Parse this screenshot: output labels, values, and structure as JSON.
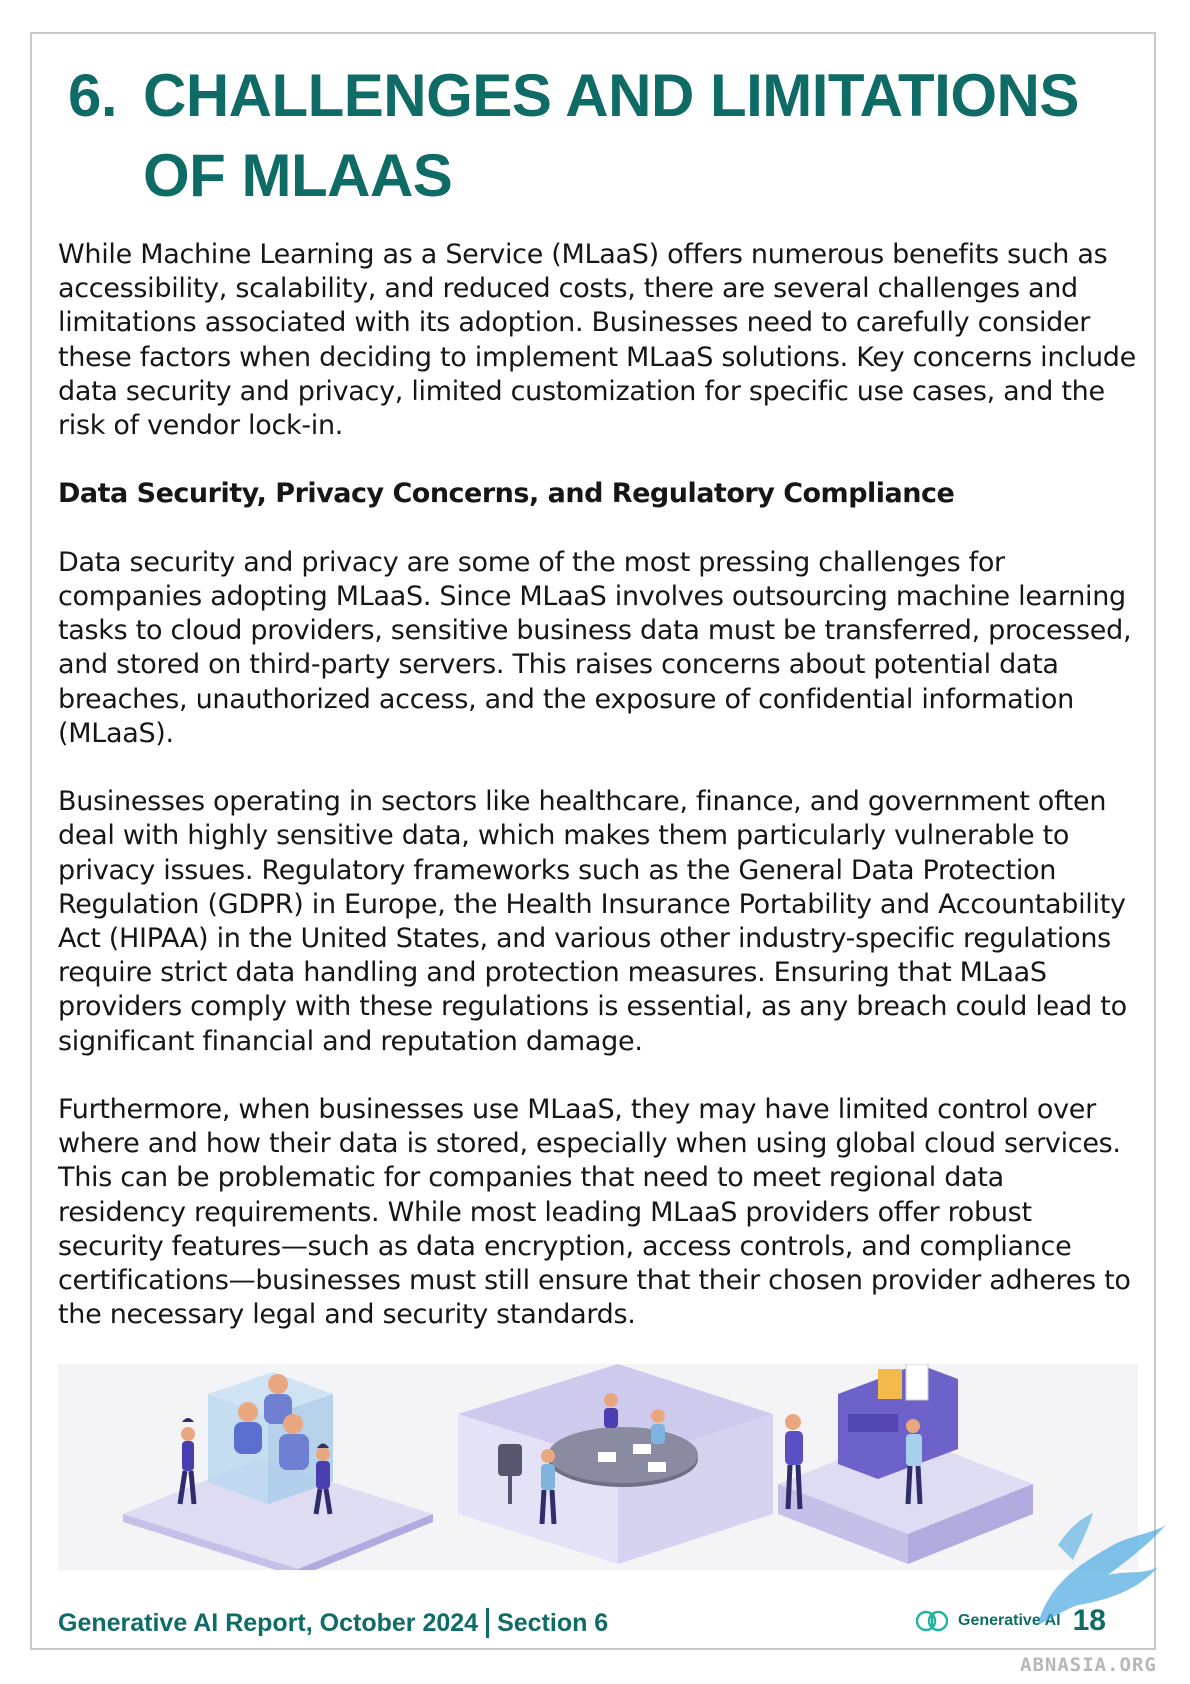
{
  "heading": {
    "number": "6.",
    "title": "CHALLENGES AND LIMITATIONS OF MLAAS"
  },
  "intro": "While Machine Learning as a Service (MLaaS) offers numerous benefits such as accessibility, scalability, and reduced costs, there are several challenges and limitations associated with its adoption. Businesses need to carefully consider these factors when deciding to implement MLaaS solutions. Key concerns include data security and privacy, limited customization for specific use cases, and the risk of vendor lock-in.",
  "section": {
    "title": "Data Security, Privacy Concerns, and Regulatory Compliance",
    "paragraphs": [
      "Data security and privacy are some of the most pressing challenges for companies adopting MLaaS. Since MLaaS involves outsourcing machine learning tasks to cloud providers, sensitive business data must be transferred, processed, and stored on third-party servers. This raises concerns about potential data breaches, unauthorized access, and the exposure of confidential information (MLaaS).",
      "Businesses operating in sectors like healthcare, finance, and government often deal with highly sensitive data, which makes them particularly vulnerable to privacy issues. Regulatory frameworks such as the General Data Protection Regulation (GDPR) in Europe, the Health Insurance Portability and Accountability Act (HIPAA) in the United States, and various other industry-specific regulations require strict data handling and protection measures. Ensuring that MLaaS providers comply with these regulations is essential, as any breach could lead to significant financial and reputation damage.",
      "Furthermore, when businesses use MLaaS, they may have limited control over where and how their data is stored, especially when using global cloud services. This can be problematic for companies that need to meet regional data residency requirements. While most leading MLaaS providers offer robust security features—such as data encryption, access controls, and compliance certifications—businesses must still ensure that their chosen provider adheres to the necessary legal and security standards."
    ]
  },
  "footer": {
    "report": "Generative AI Report, October 2024",
    "section": "Section 6",
    "brand": "Generative AI",
    "page": "18"
  },
  "watermark": "ABNASIA.ORG",
  "colors": {
    "accent": "#0e6b66",
    "illustration_purple": "#5b4fc4",
    "watermark_blue": "#4aa8e0"
  }
}
